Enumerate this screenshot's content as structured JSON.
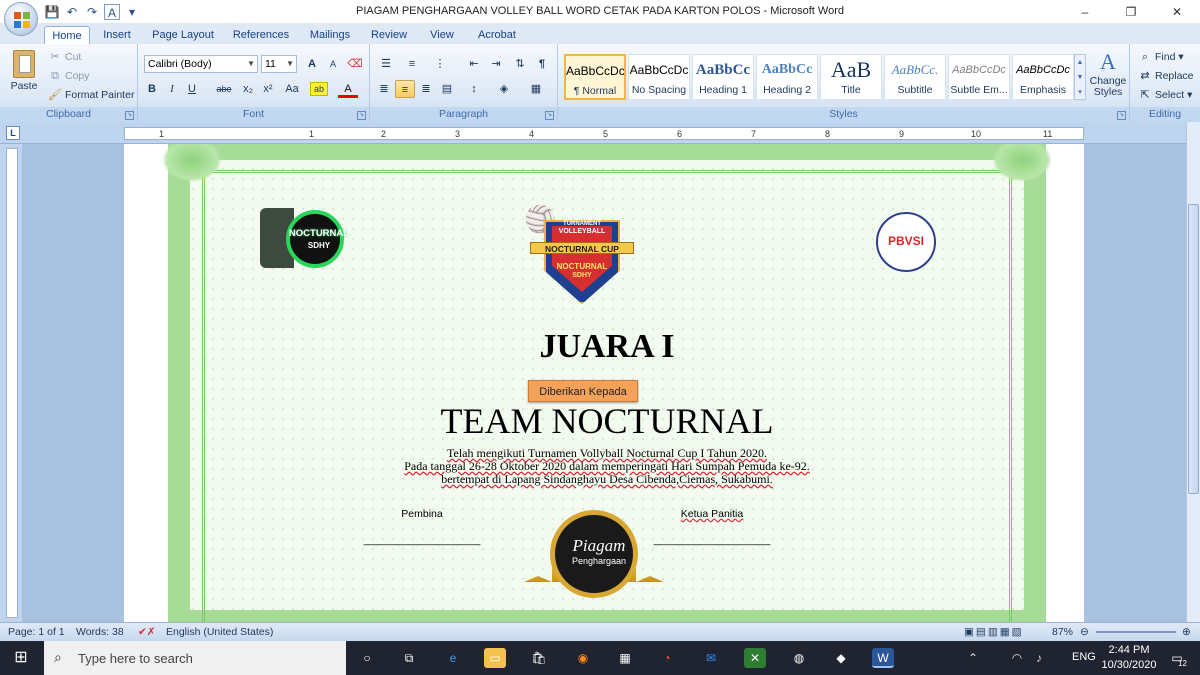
{
  "window": {
    "title": "PIAGAM PENGHARGAAN VOLLEY BALL WORD CETAK PADA KARTON POLOS - Microsoft Word",
    "minimize": "–",
    "restore": "❐",
    "close": "✕"
  },
  "tabs": [
    "Home",
    "Insert",
    "Page Layout",
    "References",
    "Mailings",
    "Review",
    "View",
    "Acrobat"
  ],
  "clipboard": {
    "paste": "Paste",
    "cut": "Cut",
    "copy": "Copy",
    "format_painter": "Format Painter",
    "label": "Clipboard"
  },
  "font": {
    "name": "Calibri (Body)",
    "size": "11",
    "label": "Font",
    "bold": "B",
    "italic": "I",
    "underline": "U",
    "strike": "abe",
    "subscript": "x₂",
    "superscript": "x²",
    "change_case": "Aa",
    "grow": "A",
    "shrink": "A"
  },
  "paragraph": {
    "label": "Paragraph",
    "pilcrow": "¶"
  },
  "styles": {
    "label": "Styles",
    "items": [
      {
        "sample": "AaBbCcDc",
        "name": "¶ Normal"
      },
      {
        "sample": "AaBbCcDc",
        "name": "No Spacing"
      },
      {
        "sample": "AaBbCc",
        "name": "Heading 1"
      },
      {
        "sample": "AaBbCc",
        "name": "Heading 2"
      },
      {
        "sample": "AaB",
        "name": "Title"
      },
      {
        "sample": "AaBbCc.",
        "name": "Subtitle"
      },
      {
        "sample": "AaBbCcDc",
        "name": "Subtle Em..."
      },
      {
        "sample": "AaBbCcDc",
        "name": "Emphasis"
      }
    ],
    "change_styles": "Change Styles"
  },
  "editing": {
    "label": "Editing",
    "find": "Find",
    "replace": "Replace",
    "select": "Select"
  },
  "ruler": {
    "tab_stop": "L",
    "numbers": [
      "1",
      "1",
      "2",
      "3",
      "4",
      "5",
      "6",
      "7",
      "8",
      "9",
      "10",
      "11"
    ]
  },
  "certificate": {
    "left_logo_text": "NOCTURNAL",
    "left_logo_sub": "SDHY",
    "center_logo_top": "TURNAMENT",
    "center_logo_mid": "VOLLEYBALL",
    "center_logo_cup": "NOCTURNAL CUP",
    "center_logo_bottom": "NOCTURNAL",
    "center_logo_sub": "SDHY",
    "right_logo_text": "PBVSI",
    "heading": "JUARA I",
    "given_to": "Diberikan Kepada",
    "recipient": "TEAM NOCTURNAL",
    "line1": "Telah mengikuti Turnamen Vollyball Nocturnal Cup I Tahun 2020.",
    "line2": "Pada tanggal  26-28 Oktober 2020 dalam memperingati Hari Sumpah Pemuda ke-92.",
    "line3": "bertempat di Lapang Sindanghayu Desa Cibenda,Ciemas, Sukabumi.",
    "left_sign_title": "Pembina",
    "right_sign_title": "Ketua Panitia",
    "signature_line": "____________________",
    "seal_title": "Piagam",
    "seal_sub": "Penghargaan"
  },
  "status": {
    "page": "Page: 1 of 1",
    "words": "Words: 38",
    "language": "English (United States)",
    "zoom": "87%"
  },
  "taskbar": {
    "search_placeholder": "Type here to search",
    "lang": "ENG",
    "time": "2:44 PM",
    "date": "10/30/2020",
    "notifications": "12"
  },
  "colors": {
    "ribbon_accent": "#15428b",
    "certificate_green": "#a7dc98",
    "given_to_bg": "#f4a15a"
  }
}
